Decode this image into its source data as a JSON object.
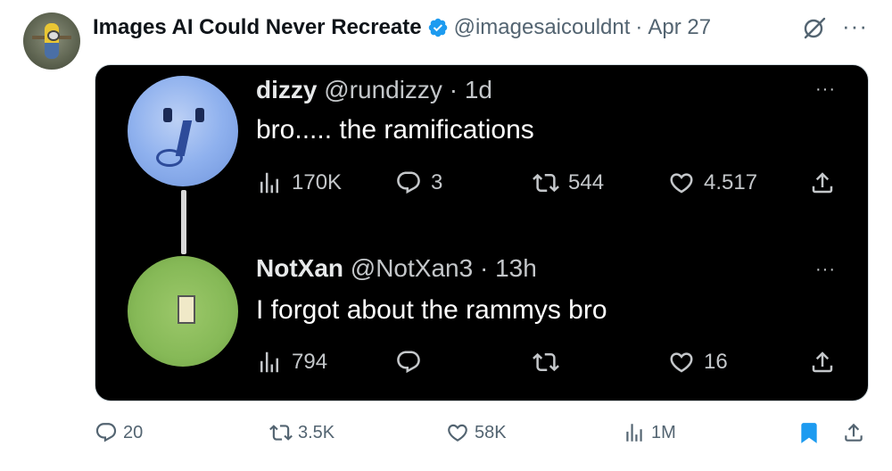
{
  "post": {
    "author_name": "Images AI Could Never Recreate",
    "handle": "@imagesaicouldnt",
    "separator": "·",
    "date": "Apr 27",
    "more": "···",
    "colors": {
      "verified": "#1d9bf0",
      "bookmark": "#1d9bf0",
      "text_secondary": "#536471"
    }
  },
  "quoted": [
    {
      "name": "dizzy",
      "handle": "@rundizzy",
      "sep": "·",
      "time": "1d",
      "text": "bro..... the ramifications",
      "more": "···",
      "views": "170K",
      "replies": "3",
      "reposts": "544",
      "likes": "4.517"
    },
    {
      "name": "NotXan",
      "handle": "@NotXan3",
      "sep": "·",
      "time": "13h",
      "text": "I forgot about the rammys bro",
      "more": "···",
      "views": "794",
      "replies": "",
      "reposts": "",
      "likes": "16"
    }
  ],
  "footer": {
    "replies": "20",
    "reposts": "3.5K",
    "likes": "58K",
    "views": "1M"
  },
  "icons": [
    "verified-badge-icon",
    "grok-icon",
    "more-icon",
    "views-icon",
    "reply-icon",
    "repost-icon",
    "like-icon",
    "share-icon",
    "bookmark-icon"
  ]
}
